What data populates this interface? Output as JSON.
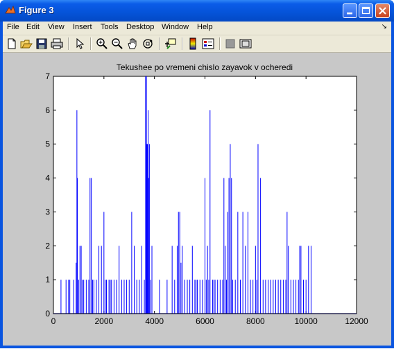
{
  "window": {
    "title": "Figure 3",
    "titlebar_color": "#0553d8",
    "figure_bg": "#c8c8c8",
    "buttons": [
      "minimize-icon",
      "maximize-icon",
      "close-icon"
    ]
  },
  "menu": {
    "items": [
      {
        "label": "File"
      },
      {
        "label": "Edit"
      },
      {
        "label": "View"
      },
      {
        "label": "Insert"
      },
      {
        "label": "Tools"
      },
      {
        "label": "Desktop"
      },
      {
        "label": "Window"
      },
      {
        "label": "Help"
      }
    ],
    "overflow": "↘"
  },
  "toolbar": {
    "tools": [
      "new-figure-icon",
      "open-file-icon",
      "save-icon",
      "print-icon",
      "pointer-icon",
      "zoom-in-icon",
      "zoom-out-icon",
      "pan-hand-icon",
      "rotate-3d-icon",
      "data-cursor-icon",
      "colorbar-icon",
      "legend-icon",
      "hide-plot-tools-icon",
      "show-plot-tools-icon"
    ]
  },
  "chart_data": {
    "type": "line",
    "title": "Tekushee po vremeni chislo zayavok v ocheredi",
    "xlabel": "",
    "ylabel": "",
    "xlim": [
      0,
      12000
    ],
    "ylim": [
      0,
      7
    ],
    "xticks": [
      "0",
      "2000",
      "4000",
      "6000",
      "8000",
      "10000",
      "12000"
    ],
    "yticks": [
      "0",
      "1",
      "2",
      "3",
      "4",
      "5",
      "6",
      "7"
    ],
    "line_color": "#0000ff",
    "grid": false,
    "series": [
      {
        "x": [
          300,
          500,
          600,
          650,
          800,
          900,
          930,
          950,
          1000,
          1050,
          1100,
          1150,
          1200,
          1300,
          1400,
          1450,
          1500,
          1550,
          1600,
          1700,
          1800,
          1900,
          2000,
          2050,
          2100,
          2200,
          2250,
          2300,
          2400,
          2500,
          2600,
          2700,
          2800,
          2900,
          3000,
          3100,
          3200,
          3300,
          3400,
          3500,
          3600,
          3650,
          3680,
          3700,
          3720,
          3750,
          3780,
          3800,
          3850,
          3900,
          4200,
          4500,
          4700,
          4800,
          4900,
          4950,
          5000,
          5050,
          5100,
          5200,
          5300,
          5400,
          5500,
          5600,
          5650,
          5700,
          5800,
          5900,
          6000,
          6050,
          6100,
          6150,
          6200,
          6300,
          6350,
          6400,
          6500,
          6600,
          6700,
          6750,
          6800,
          6850,
          6900,
          6950,
          7000,
          7050,
          7100,
          7200,
          7300,
          7400,
          7500,
          7600,
          7700,
          7800,
          7900,
          8000,
          8050,
          8100,
          8200,
          8300,
          8400,
          8500,
          8600,
          8700,
          8800,
          8900,
          9000,
          9100,
          9200,
          9250,
          9300,
          9400,
          9500,
          9600,
          9700,
          9750,
          9800,
          9900,
          10000,
          10100,
          10200
        ],
        "y": [
          1,
          1,
          1,
          1,
          1,
          1.5,
          6,
          4,
          1,
          2,
          2,
          1,
          1,
          1,
          1,
          4,
          4,
          1,
          1,
          1,
          2,
          2,
          3,
          1,
          1,
          1,
          1,
          1,
          1,
          1,
          2,
          1,
          1,
          1,
          1,
          3,
          2,
          1,
          1,
          2,
          1,
          7,
          7,
          5,
          5,
          6,
          4,
          5,
          1,
          2,
          1,
          1,
          2,
          1,
          2,
          3,
          3,
          1.5,
          2,
          1,
          1,
          1,
          2,
          1,
          1,
          1,
          1,
          1,
          4,
          1,
          2,
          1,
          6,
          1,
          1,
          1,
          1,
          1,
          1,
          4,
          2,
          1,
          3,
          4,
          5,
          4,
          1,
          1,
          3,
          1,
          3,
          2,
          3,
          1,
          1,
          2,
          1,
          5,
          4,
          1,
          1,
          1,
          1,
          1,
          1,
          1,
          1,
          1,
          1,
          3,
          2,
          1,
          1,
          1,
          1,
          2,
          2,
          1,
          1,
          2,
          2
        ]
      }
    ]
  }
}
